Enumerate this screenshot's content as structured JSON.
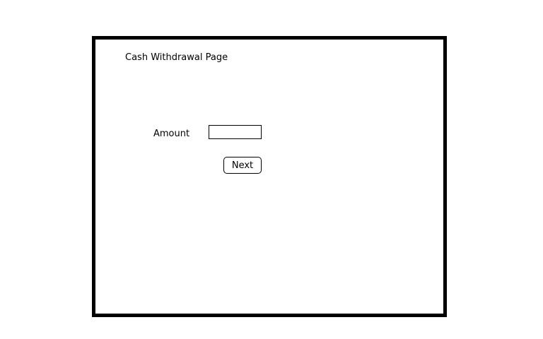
{
  "page": {
    "title": "Cash Withdrawal Page"
  },
  "form": {
    "amount_label": "Amount",
    "amount_value": "",
    "next_label": "Next"
  },
  "colors": {
    "border": "#000000",
    "background": "#ffffff",
    "text": "#000000"
  }
}
